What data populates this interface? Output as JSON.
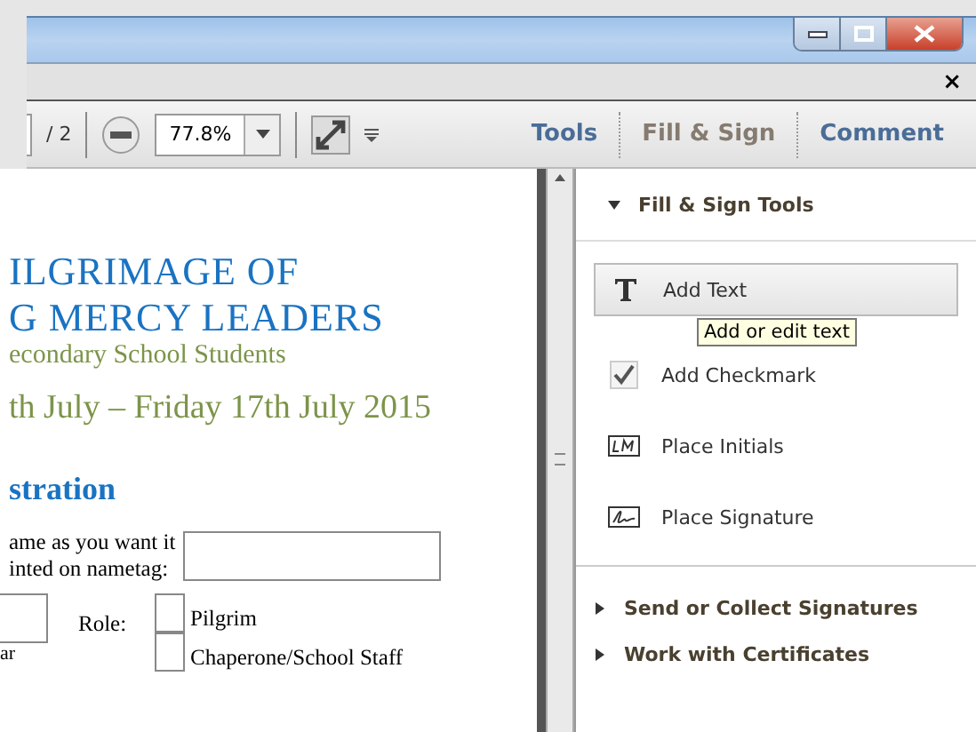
{
  "window": {
    "close_label": "×"
  },
  "toolbar": {
    "page_total": "/ 2",
    "zoom": "77.8%"
  },
  "tabs": [
    {
      "label": "Tools",
      "selected": false
    },
    {
      "label": "Fill & Sign",
      "selected": true
    },
    {
      "label": "Comment",
      "selected": false
    }
  ],
  "document": {
    "title_lines": [
      "ILGRIMAGE OF",
      "G MERCY LEADERS"
    ],
    "subtitle": "econdary School Students",
    "dates": "th July – Friday 17th July 2015",
    "heading": "stration",
    "name_label_lines": [
      "ame as you want it",
      "inted on nametag:"
    ],
    "role_label": "Role:",
    "roles": [
      {
        "label": "Pilgrim",
        "checked": false
      },
      {
        "label": "Chaperone/School Staff",
        "checked": false
      }
    ],
    "year_label": "ar"
  },
  "panel": {
    "sections": [
      {
        "title": "Fill & Sign Tools",
        "expanded": true,
        "items": [
          {
            "kind": "text",
            "label": "Add Text",
            "selected": true
          },
          {
            "kind": "check",
            "label": "Add Checkmark",
            "selected": false
          },
          {
            "kind": "initials",
            "label": "Place Initials",
            "selected": false
          },
          {
            "kind": "signature",
            "label": "Place Signature",
            "selected": false
          }
        ]
      },
      {
        "title": "Send or Collect Signatures",
        "expanded": false
      },
      {
        "title": "Work with Certificates",
        "expanded": false
      }
    ]
  },
  "tooltip": "Add or edit text"
}
